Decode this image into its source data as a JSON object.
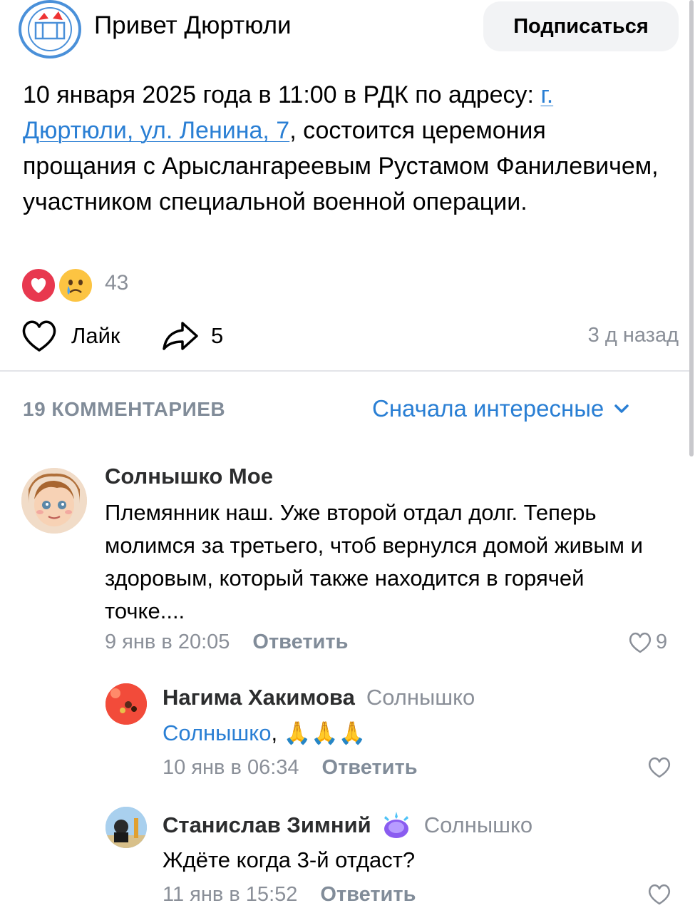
{
  "group": {
    "name": "Привет Дюртюли",
    "subscribe_label": "Подписаться"
  },
  "post": {
    "text_before": "10 января 2025 года в 11:00 в РДК по адресу: ",
    "link_text": "г. Дюртюли, ул. Ленина, 7",
    "text_after": ", состоится церемония прощания с Арыслангареевым Рустамом Фанилевичем, участником специальной военной операции.",
    "reactions_count": "43",
    "like_label": "Лайк",
    "shares_count": "5",
    "time": "3 д назад"
  },
  "comments_header": {
    "count_label": "19 КОММЕНТАРИЕВ",
    "sort_label": "Сначала интересные"
  },
  "comments": [
    {
      "author": "Солнышко Мое",
      "text": "Племянник наш. Уже второй  отдал долг. Теперь молимся за третьего, чтоб вернулся домой живым и здоровым, который также находится в горячей точке....",
      "date": "9 янв в 20:05",
      "reply_label": "Ответить",
      "likes": "9"
    },
    {
      "author": "Нагима Хакимова",
      "reply_to": "Солнышко",
      "mention": "Солнышко",
      "text": ", 🙏🙏🙏",
      "date": "10 янв в 06:34",
      "reply_label": "Ответить",
      "likes": ""
    },
    {
      "author": "Станислав Зимний",
      "reply_to": "Солнышко",
      "text": "Ждёте когда 3-й отдаст?",
      "date": "11 янв в 15:52",
      "reply_label": "Ответить",
      "likes": ""
    }
  ],
  "colors": {
    "accent": "#2a7fd4",
    "secondary_text": "#8a8f98",
    "heart_reaction": "#e8384f",
    "emoji_reaction": "#fcc442"
  },
  "icons": [
    "heart-outline-icon",
    "share-arrow-icon",
    "chevron-down-icon",
    "heart-reaction-icon",
    "crying-face-icon",
    "sparkle-badge-icon"
  ]
}
